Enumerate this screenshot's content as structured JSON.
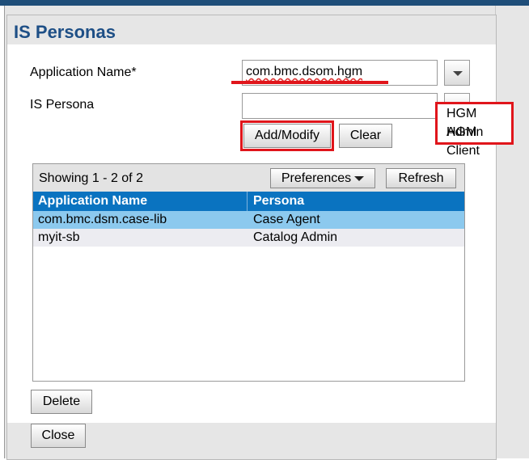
{
  "dialog": {
    "title": "IS Personas"
  },
  "form": {
    "application_name_label": "Application Name*",
    "application_name_value": "com.bmc.dsom.hgm",
    "is_persona_label": "IS Persona",
    "is_persona_value": ""
  },
  "buttons": {
    "add_modify": "Add/Modify",
    "clear": "Clear",
    "preferences": "Preferences",
    "refresh": "Refresh",
    "delete": "Delete",
    "close": "Close"
  },
  "persona_dropdown": {
    "options": [
      "HGM Admin",
      "HGM Client"
    ]
  },
  "grid": {
    "showing": "Showing 1 - 2 of 2",
    "columns": [
      "Application Name",
      "Persona"
    ],
    "rows": [
      {
        "application_name": "com.bmc.dsm.case-lib",
        "persona": "Case Agent",
        "selected": true
      },
      {
        "application_name": "myit-sb",
        "persona": "Catalog Admin",
        "selected": false
      }
    ]
  },
  "colors": {
    "title": "#1e4f86",
    "grid_header": "#0a73c0",
    "selected_row": "#8cc9ee",
    "alt_row": "#ececf1",
    "highlight": "#e0151b"
  }
}
